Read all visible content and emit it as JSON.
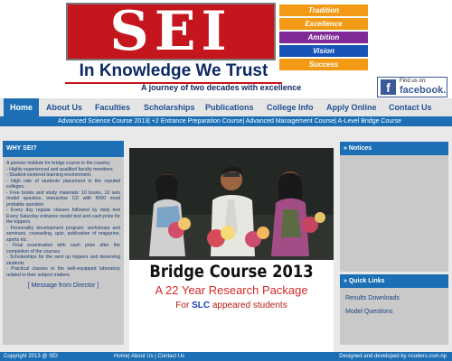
{
  "header": {
    "logo": "SEI",
    "tagline": "In Knowledge We Trust",
    "subtitle": "A journey of two decades with excellence",
    "values": [
      {
        "label": "Tradition",
        "color": "#f29a16"
      },
      {
        "label": "Excellence",
        "color": "#f29a16"
      },
      {
        "label": "Ambition",
        "color": "#7f2a97"
      },
      {
        "label": "Vision",
        "color": "#1754b8"
      },
      {
        "label": "Success",
        "color": "#f29a16"
      }
    ],
    "facebook": {
      "small": "Find us on:",
      "big": "facebook.",
      "icon": "f"
    }
  },
  "nav": {
    "items": [
      "Home",
      "About Us",
      "Faculties",
      "Scholarships",
      "Publications",
      "College Info",
      "Apply Online",
      "Contact Us"
    ],
    "subnav": "Advanced Science Course 2013| +2 Entrance Preparation Course| Advanced Management Course| A-Level Bridge Course"
  },
  "left": {
    "heading": "WHY SEI?",
    "body": "A pioneer institute for bridge course in the country.\n- Highly experienced and qualified faculty members.\n- Student-centered learning environment.\n- High rate of students' placement in the reputed colleges.\n- Free books and study materials: 10 books, 10 sets model question, interactive CD with 5000 most probable question\n- Every day regular classes followed by daily test Every Saturday entrance model test and cash prize for the toppers.\n- Personality development program: workshops and seminars, counseling, quiz, publication of magazine, sports etc.\n- Final examination with cash prize after the completion of the courses.\n- Scholarships for the sent up toppers and deserving students\n- Practical classes in the well-equipped laboratory related to their subject matters.",
    "link": "[ Message from Director ]"
  },
  "center": {
    "title": "Bridge Course 2013",
    "subtitle": "A 22 Year Research Package",
    "slc_prefix": "For ",
    "slc_highlight": "SLC",
    "slc_suffix": " appeared students"
  },
  "right": {
    "notices_heading": "» Notices",
    "quick_heading": "» Quick Links",
    "links": [
      "Results Downloads",
      "Model Questions"
    ]
  },
  "footer": {
    "copyright": "Copyright 2013 @ SEI",
    "links": "Home| About Us | Contact Us",
    "designed": "Designed and developed by ncoders.com.np"
  }
}
